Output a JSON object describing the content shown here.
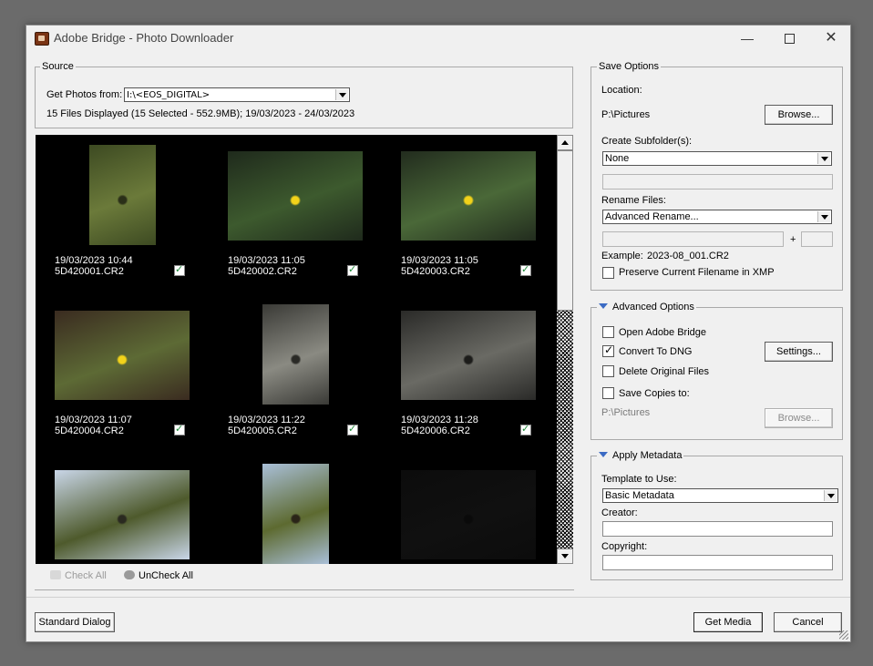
{
  "window": {
    "title": "Adobe Bridge - Photo Downloader",
    "controls": {
      "minimize": "—",
      "close": "✕"
    }
  },
  "source": {
    "legend": "Source",
    "get_photos_label": "Get Photos from:",
    "device": "I:\\<EOS_DIGITAL>",
    "summary": "15 Files Displayed (15 Selected - 552.9MB); 19/03/2023 - 24/03/2023"
  },
  "thumbnails": [
    {
      "date": "19/03/2023 10:44",
      "file": "5D420001.CR2",
      "checked": true,
      "palette": [
        "#3d4a22",
        "#6b7a3a",
        "#2a2f18"
      ]
    },
    {
      "date": "19/03/2023 11:05",
      "file": "5D420002.CR2",
      "checked": true,
      "palette": [
        "#1f2a1c",
        "#3d5a2e",
        "#f2d21a"
      ]
    },
    {
      "date": "19/03/2023 11:05",
      "file": "5D420003.CR2",
      "checked": true,
      "palette": [
        "#222c1e",
        "#4a6838",
        "#f2d21a"
      ]
    },
    {
      "date": "19/03/2023 11:07",
      "file": "5D420004.CR2",
      "checked": true,
      "palette": [
        "#3a2b20",
        "#5d6a35",
        "#f2d21a"
      ]
    },
    {
      "date": "19/03/2023 11:22",
      "file": "5D420005.CR2",
      "checked": true,
      "palette": [
        "#3a3a36",
        "#8a8a82",
        "#2a2a26"
      ]
    },
    {
      "date": "19/03/2023 11:28",
      "file": "5D420006.CR2",
      "checked": true,
      "palette": [
        "#2a2a28",
        "#6a6a64",
        "#1c1c1a"
      ]
    },
    {
      "date": "",
      "file": "",
      "checked": false,
      "palette": [
        "#c9d6e8",
        "#4e5a2c",
        "#2a2a20"
      ]
    },
    {
      "date": "",
      "file": "",
      "checked": false,
      "palette": [
        "#a9bfd8",
        "#5d6a30",
        "#2a2418"
      ]
    },
    {
      "date": "",
      "file": "",
      "checked": false,
      "palette": [
        "#0c0c0c",
        "#101010",
        "#0a0a0a"
      ]
    }
  ],
  "toolbar": {
    "check_all": "Check All",
    "uncheck_all": "UnCheck All"
  },
  "save_options": {
    "legend": "Save Options",
    "location_label": "Location:",
    "location_value": "P:\\Pictures",
    "browse": "Browse...",
    "subfolder_label": "Create Subfolder(s):",
    "subfolder_value": "None",
    "rename_label": "Rename Files:",
    "rename_value": "Advanced Rename...",
    "plus": "+",
    "example_label": "Example:",
    "example_value": "2023-08_001.CR2",
    "preserve_label": "Preserve Current Filename in XMP"
  },
  "advanced_options": {
    "legend": "Advanced Options",
    "open_bridge": "Open Adobe Bridge",
    "convert_dng": "Convert To DNG",
    "settings": "Settings...",
    "delete_originals": "Delete Original Files",
    "save_copies": "Save Copies to:",
    "copies_path": "P:\\Pictures",
    "browse": "Browse..."
  },
  "apply_metadata": {
    "legend": "Apply Metadata",
    "template_label": "Template to Use:",
    "template_value": "Basic Metadata",
    "creator_label": "Creator:",
    "copyright_label": "Copyright:"
  },
  "footer": {
    "standard_dialog": "Standard Dialog",
    "get_media": "Get Media",
    "cancel": "Cancel"
  }
}
